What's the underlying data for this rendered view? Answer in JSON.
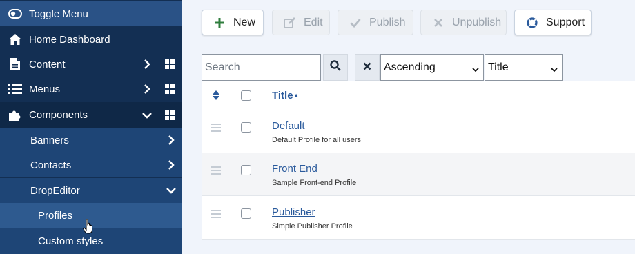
{
  "sidebar": {
    "toggle_label": "Toggle Menu",
    "home_label": "Home Dashboard",
    "content_label": "Content",
    "menus_label": "Menus",
    "components_label": "Components",
    "submenu": {
      "banners": "Banners",
      "contacts": "Contacts",
      "dropeditor": "DropEditor",
      "profiles": "Profiles",
      "custom_styles": "Custom styles"
    }
  },
  "toolbar": {
    "new_label": "New",
    "edit_label": "Edit",
    "publish_label": "Publish",
    "unpublish_label": "Unpublish",
    "support_label": "Support"
  },
  "filters": {
    "search_placeholder": "Search",
    "search_value": "",
    "order_direction": "Ascending",
    "order_field": "Title"
  },
  "table": {
    "title_header": "Title",
    "rows": [
      {
        "title": "Default",
        "description": "Default Profile for all users"
      },
      {
        "title": "Front End",
        "description": "Sample Front-end Profile"
      },
      {
        "title": "Publisher",
        "description": "Simple Publisher Profile"
      }
    ]
  },
  "colors": {
    "sidebar_bg": "#132f53",
    "active_item": "#2e5a8f",
    "accent_link": "#2a5a9c",
    "new_icon": "#2f7d3d"
  }
}
